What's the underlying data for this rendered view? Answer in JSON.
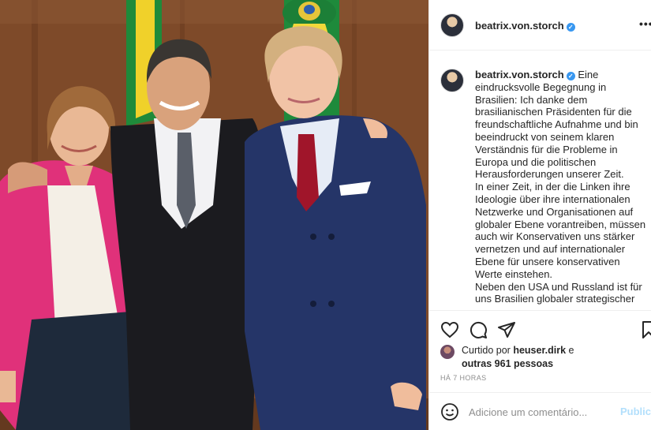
{
  "post": {
    "username": "beatrix.von.storch",
    "verified": true,
    "caption_paragraphs": [
      "Eine eindrucksvolle Begegnung in Brasilien: Ich danke dem brasilianischen Präsidenten für die freundschaftliche Aufnahme und bin beeindruckt von seinem klaren Verständnis für die Probleme in Europa und die politischen Herausforderungen unserer Zeit.",
      "In einer Zeit, in der die Linken ihre Ideologie über ihre internationalen Netzwerke und Organisationen auf globaler Ebene vorantreiben, müssen auch wir Konservativen uns stärker vernetzen und auf internationaler Ebene für unsere konservativen Werte einstehen.",
      "Neben den USA und Russland ist für uns Brasilien globaler strategischer"
    ]
  },
  "likes": {
    "prefix": "Curtido por",
    "user": "heuser.dirk",
    "connector": "e",
    "others": "outras 961 pessoas"
  },
  "timestamp": "HÁ 7 HORAS",
  "comment": {
    "placeholder": "Adicione um comentário...",
    "publish_label": "Publicar"
  },
  "icons": {
    "more": "more-options-icon",
    "like": "heart-icon",
    "comment": "comment-icon",
    "share": "share-icon",
    "save": "bookmark-icon",
    "emoji": "emoji-icon"
  },
  "colors": {
    "verified": "#3897f0",
    "publish_disabled": "#b2dffc",
    "muted_text": "#8e8e8e"
  }
}
